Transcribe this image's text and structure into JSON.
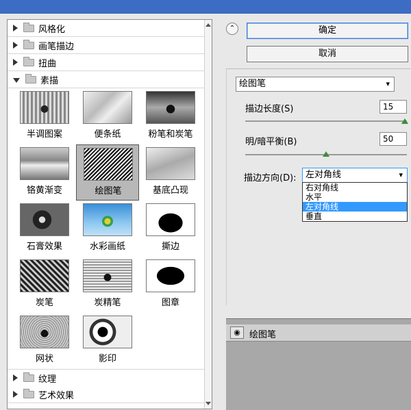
{
  "tree": {
    "folders_top": [
      {
        "label": "风格化",
        "expanded": false
      },
      {
        "label": "画笔描边",
        "expanded": false
      },
      {
        "label": "扭曲",
        "expanded": false
      },
      {
        "label": "素描",
        "expanded": true
      }
    ],
    "thumbs": [
      {
        "label": "半调图案"
      },
      {
        "label": "便条纸"
      },
      {
        "label": "粉笔和炭笔"
      },
      {
        "label": "铬黄渐变"
      },
      {
        "label": "绘图笔",
        "selected": true
      },
      {
        "label": "基底凸现"
      },
      {
        "label": "石膏效果"
      },
      {
        "label": "水彩画纸"
      },
      {
        "label": "撕边"
      },
      {
        "label": "炭笔"
      },
      {
        "label": "炭精笔"
      },
      {
        "label": "图章"
      },
      {
        "label": "网状"
      },
      {
        "label": "影印"
      }
    ],
    "folders_bottom": [
      {
        "label": "纹理",
        "expanded": false
      },
      {
        "label": "艺术效果",
        "expanded": false
      }
    ]
  },
  "buttons": {
    "ok": "确定",
    "cancel": "取消"
  },
  "filter_select": {
    "value": "绘图笔"
  },
  "params": {
    "stroke_length": {
      "label": "描边长度(S)",
      "value": "15",
      "fraction": 1.0
    },
    "balance": {
      "label": "明/暗平衡(B)",
      "value": "50",
      "fraction": 0.5
    },
    "direction": {
      "label": "描边方向(D):",
      "value": "左对角线"
    }
  },
  "direction_options": [
    {
      "label": "右对角线",
      "highlighted": false
    },
    {
      "label": "水平",
      "highlighted": false
    },
    {
      "label": "左对角线",
      "highlighted": true
    },
    {
      "label": "垂直",
      "highlighted": false
    }
  ],
  "layers": {
    "items": [
      {
        "name": "绘图笔"
      }
    ]
  },
  "colors": {
    "title_bar": "#3c6cc4",
    "highlight": "#3399ff",
    "slider_thumb": "#3d8c3d"
  }
}
